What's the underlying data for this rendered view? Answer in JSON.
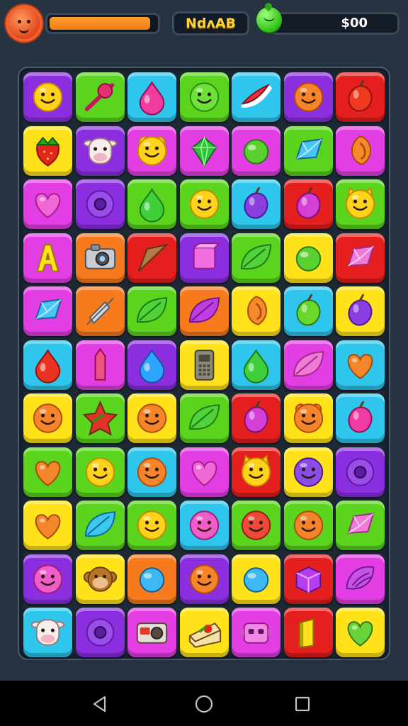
{
  "hud": {
    "level_label": "NdᴧAB",
    "coins_label": "$00",
    "energy_fraction": 0.95,
    "colors": {
      "energy": "#f58a1a",
      "level_text": "#ffd335"
    }
  },
  "board": {
    "rows": 11,
    "cols": 7,
    "palette": {
      "purple": "#8b2ee0",
      "green": "#5ad41c",
      "cyan": "#2ec6ec",
      "red": "#e51e1e",
      "yellow": "#ffe21a",
      "magenta": "#e23ee4",
      "orange": "#f77a1c"
    },
    "tiles": [
      [
        {
          "bg": "purple",
          "icon": "smiley-yellow"
        },
        {
          "bg": "green",
          "icon": "candy-stick"
        },
        {
          "bg": "cyan",
          "icon": "pink-drop"
        },
        {
          "bg": "green",
          "icon": "smiley-green"
        },
        {
          "bg": "cyan",
          "icon": "watermelon-slice"
        },
        {
          "bg": "purple",
          "icon": "smiley-orange"
        },
        {
          "bg": "red",
          "icon": "red-fruit"
        }
      ],
      [
        {
          "bg": "yellow",
          "icon": "strawberry"
        },
        {
          "bg": "purple",
          "icon": "cow-face"
        },
        {
          "bg": "magenta",
          "icon": "bear-yellow"
        },
        {
          "bg": "magenta",
          "icon": "green-gem"
        },
        {
          "bg": "magenta",
          "icon": "green-ball"
        },
        {
          "bg": "green",
          "icon": "blue-crystal"
        },
        {
          "bg": "magenta",
          "icon": "orange-shell"
        }
      ],
      [
        {
          "bg": "magenta",
          "icon": "heart-pink"
        },
        {
          "bg": "purple",
          "icon": "purple-ring"
        },
        {
          "bg": "green",
          "icon": "green-drop"
        },
        {
          "bg": "green",
          "icon": "smiley-yellow"
        },
        {
          "bg": "cyan",
          "icon": "purple-plum"
        },
        {
          "bg": "red",
          "icon": "purple-berry"
        },
        {
          "bg": "green",
          "icon": "cat-yellow"
        }
      ],
      [
        {
          "bg": "magenta",
          "icon": "yellow-letter-a"
        },
        {
          "bg": "orange",
          "icon": "camera"
        },
        {
          "bg": "red",
          "icon": "brown-arrow"
        },
        {
          "bg": "purple",
          "icon": "pink-cube"
        },
        {
          "bg": "green",
          "icon": "green-leaf"
        },
        {
          "bg": "yellow",
          "icon": "green-ball"
        },
        {
          "bg": "red",
          "icon": "pink-candy"
        }
      ],
      [
        {
          "bg": "magenta",
          "icon": "blue-crystal"
        },
        {
          "bg": "orange",
          "icon": "silver-arrow"
        },
        {
          "bg": "green",
          "icon": "green-leaf"
        },
        {
          "bg": "orange",
          "icon": "purple-leaf"
        },
        {
          "bg": "yellow",
          "icon": "orange-shell"
        },
        {
          "bg": "cyan",
          "icon": "green-plum"
        },
        {
          "bg": "yellow",
          "icon": "purple-plum"
        }
      ],
      [
        {
          "bg": "cyan",
          "icon": "red-berry"
        },
        {
          "bg": "magenta",
          "icon": "pink-crystal"
        },
        {
          "bg": "purple",
          "icon": "blue-drop"
        },
        {
          "bg": "yellow",
          "icon": "phone"
        },
        {
          "bg": "cyan",
          "icon": "green-drop"
        },
        {
          "bg": "magenta",
          "icon": "pink-leaf"
        },
        {
          "bg": "cyan",
          "icon": "orange-heart"
        }
      ],
      [
        {
          "bg": "yellow",
          "icon": "smiley-orange"
        },
        {
          "bg": "green",
          "icon": "red-star"
        },
        {
          "bg": "yellow",
          "icon": "smiley-orange"
        },
        {
          "bg": "green",
          "icon": "green-leaf"
        },
        {
          "bg": "red",
          "icon": "purple-berry"
        },
        {
          "bg": "yellow",
          "icon": "bear-orange"
        },
        {
          "bg": "cyan",
          "icon": "pink-berry"
        }
      ],
      [
        {
          "bg": "green",
          "icon": "orange-heart"
        },
        {
          "bg": "green",
          "icon": "smiley-yellow"
        },
        {
          "bg": "cyan",
          "icon": "smiley-orange"
        },
        {
          "bg": "magenta",
          "icon": "heart-pink"
        },
        {
          "bg": "red",
          "icon": "cat-yellow"
        },
        {
          "bg": "yellow",
          "icon": "smiley-purple"
        },
        {
          "bg": "purple",
          "icon": "purple-ring"
        }
      ],
      [
        {
          "bg": "yellow",
          "icon": "orange-heart"
        },
        {
          "bg": "green",
          "icon": "blue-leaf"
        },
        {
          "bg": "green",
          "icon": "smiley-yellow"
        },
        {
          "bg": "cyan",
          "icon": "smiley-pink"
        },
        {
          "bg": "green",
          "icon": "smiley-red"
        },
        {
          "bg": "green",
          "icon": "smiley-orange"
        },
        {
          "bg": "green",
          "icon": "pink-candy"
        }
      ],
      [
        {
          "bg": "purple",
          "icon": "smiley-pink"
        },
        {
          "bg": "yellow",
          "icon": "monkey-face"
        },
        {
          "bg": "orange",
          "icon": "blue-ball"
        },
        {
          "bg": "purple",
          "icon": "smiley-orange"
        },
        {
          "bg": "yellow",
          "icon": "blue-ball"
        },
        {
          "bg": "red",
          "icon": "purple-cube"
        },
        {
          "bg": "magenta",
          "icon": "purple-shell"
        }
      ],
      [
        {
          "bg": "cyan",
          "icon": "cow-face"
        },
        {
          "bg": "purple",
          "icon": "purple-ring"
        },
        {
          "bg": "magenta",
          "icon": "camera-red"
        },
        {
          "bg": "yellow",
          "icon": "cake-slice"
        },
        {
          "bg": "magenta",
          "icon": "pink-robot"
        },
        {
          "bg": "red",
          "icon": "yellow-bar"
        },
        {
          "bg": "yellow",
          "icon": "green-heart"
        }
      ]
    ]
  },
  "nav": {
    "back_icon": "triangle-back-icon",
    "home_icon": "circle-home-icon",
    "recent_icon": "square-recent-icon"
  }
}
